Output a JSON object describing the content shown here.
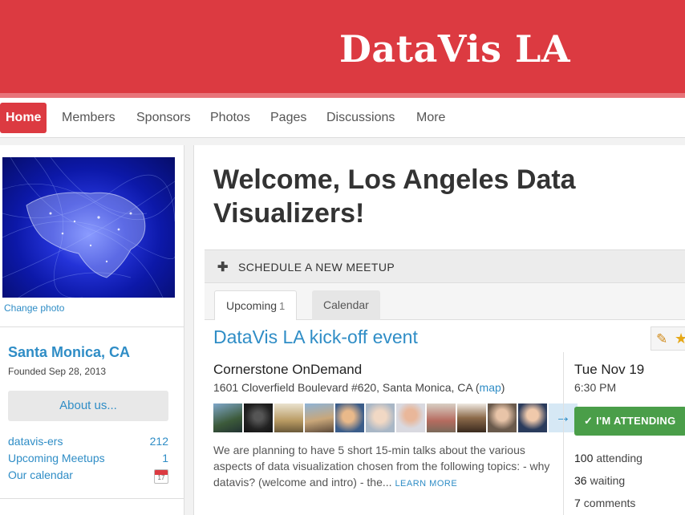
{
  "header": {
    "title": "DataVis LA"
  },
  "nav": {
    "items": [
      {
        "label": "Home",
        "active": true
      },
      {
        "label": "Members"
      },
      {
        "label": "Sponsors"
      },
      {
        "label": "Photos"
      },
      {
        "label": "Pages"
      },
      {
        "label": "Discussions"
      },
      {
        "label": "More"
      }
    ]
  },
  "sidebar": {
    "change_photo": "Change photo",
    "city": "Santa Monica, CA",
    "founded": "Founded Sep 28, 2013",
    "about_button": "About us...",
    "stats": [
      {
        "label": "datavis-ers",
        "value": "212"
      },
      {
        "label": "Upcoming Meetups",
        "value": "1"
      },
      {
        "label": "Our calendar",
        "icon": "calendar-icon",
        "icon_day": "17"
      }
    ]
  },
  "main": {
    "welcome": "Welcome, Los Angeles Data Visualizers!",
    "schedule_icon": "plus-icon",
    "schedule_label": "SCHEDULE A NEW MEETUP",
    "tabs": [
      {
        "label": "Upcoming",
        "count": "1",
        "active": true
      },
      {
        "label": "Calendar"
      }
    ],
    "event": {
      "title": "DataVis LA kick-off event",
      "venue": "Cornerstone OnDemand",
      "address": "1601 Cloverfield Boulevard #620, Santa Monica, CA (",
      "map_link": "map",
      "address_close": ")",
      "more_arrow": "→",
      "description": "We are planning to have 5 short 15-min talks about the various aspects of data visualization chosen from the following topics: - why datavis? (welcome and intro) - the...",
      "learn_more": "LEARN MORE",
      "date": "Tue Nov 19",
      "time": "6:30 PM",
      "attend_button": "✓ I'M ATTENDING",
      "attending_count": "100",
      "attending_label": "attending",
      "waiting_count": "36",
      "waiting_label": "waiting",
      "comments_count": "7",
      "comments_label": "comments"
    },
    "accent_colors": {
      "brand": "#dc3a41",
      "link": "#2f8dc6",
      "attend": "#4a9e49"
    }
  }
}
